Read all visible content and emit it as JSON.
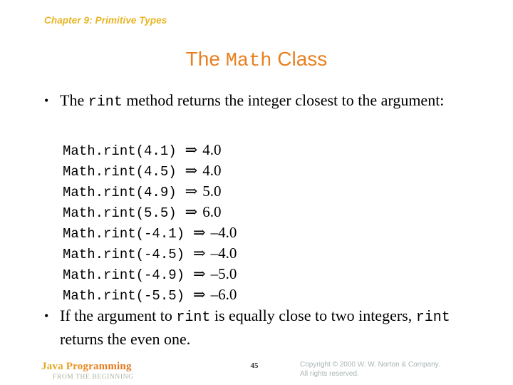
{
  "slide": {
    "chapter_header": "Chapter 9: Primitive Types",
    "title": {
      "prefix": "The ",
      "mono": "Math",
      "suffix": " Class"
    },
    "bullets": [
      {
        "marker": "•",
        "part1": "The ",
        "mono1": "rint",
        "part2": " method returns the integer closest to the argument:"
      },
      {
        "marker": "•",
        "part1": "If the argument to ",
        "mono1": "rint",
        "part2": " is equally close to two integers, ",
        "mono2": "rint",
        "part3": " returns the even one."
      }
    ],
    "code_lines": [
      {
        "call": "Math.rint(4.1)",
        "arrow": "⇒",
        "result": "4.0"
      },
      {
        "call": "Math.rint(4.5)",
        "arrow": "⇒",
        "result": "4.0"
      },
      {
        "call": "Math.rint(4.9)",
        "arrow": "⇒",
        "result": "5.0"
      },
      {
        "call": "Math.rint(5.5)",
        "arrow": "⇒",
        "result": "6.0"
      },
      {
        "call": "Math.rint(-4.1)",
        "arrow": "⇒",
        "result": "–4.0"
      },
      {
        "call": "Math.rint(-4.5)",
        "arrow": "⇒",
        "result": "–4.0"
      },
      {
        "call": "Math.rint(-4.9)",
        "arrow": "⇒",
        "result": "–5.0"
      },
      {
        "call": "Math.rint(-5.5)",
        "arrow": "⇒",
        "result": "–6.0"
      }
    ],
    "footer": {
      "logo_title": "Java Programming",
      "logo_subtitle": "FROM THE BEGINNING",
      "page_number": "45",
      "copyright_line1": "Copyright © 2000 W. W. Norton & Company.",
      "copyright_line2": "All rights reserved."
    },
    "colors": {
      "chapter_header": "#e8b422",
      "title": "#e8801f",
      "body_text": "#000000",
      "logo_gradient_start": "#ddab1e",
      "logo_gradient_end": "#e0751c",
      "logo_subtitle": "#a8b49e",
      "copyright": "#a9b5b5",
      "page_number": "#333333",
      "background": "#ffffff"
    }
  }
}
